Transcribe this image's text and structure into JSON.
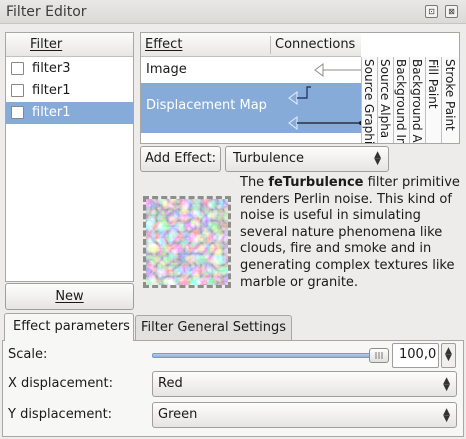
{
  "window": {
    "title": "Filter Editor",
    "btn_detach": "⊡",
    "btn_close": "⊠"
  },
  "filters": {
    "header": "Filter",
    "items": [
      {
        "name": "filter3",
        "selected": false
      },
      {
        "name": "filter1",
        "selected": false
      },
      {
        "name": "filter1",
        "selected": true
      }
    ],
    "new_button": "New"
  },
  "effects": {
    "col_effect": "Effect",
    "col_connections": "Connections",
    "rows": [
      "Image",
      "Displacement Map"
    ],
    "sources": [
      "Source Graphic",
      "Source Alpha",
      "Background Image",
      "Background Alpha",
      "Fill Paint",
      "Stroke Paint"
    ]
  },
  "add_effect": {
    "button_label": "Add Effect:",
    "selected": "Turbulence"
  },
  "description": {
    "pre": "The ",
    "bold": "feTurbulence",
    "post": " filter primitive renders Perlin noise. This kind of noise is useful in simulating several nature phenomena like clouds, fire and smoke and in generating complex textures like marble or granite."
  },
  "tabs": [
    {
      "label": "Effect parameters",
      "active": true
    },
    {
      "label": "Filter General Settings",
      "active": false
    }
  ],
  "params": {
    "scale_label": "Scale:",
    "scale_value": "100,0",
    "scale_fraction": 1.0,
    "x_label": "X displacement:",
    "x_value": "Red",
    "y_label": "Y displacement:",
    "y_value": "Green"
  },
  "colors": {
    "selection": "#86abd9",
    "window_bg": "#edeceb"
  }
}
